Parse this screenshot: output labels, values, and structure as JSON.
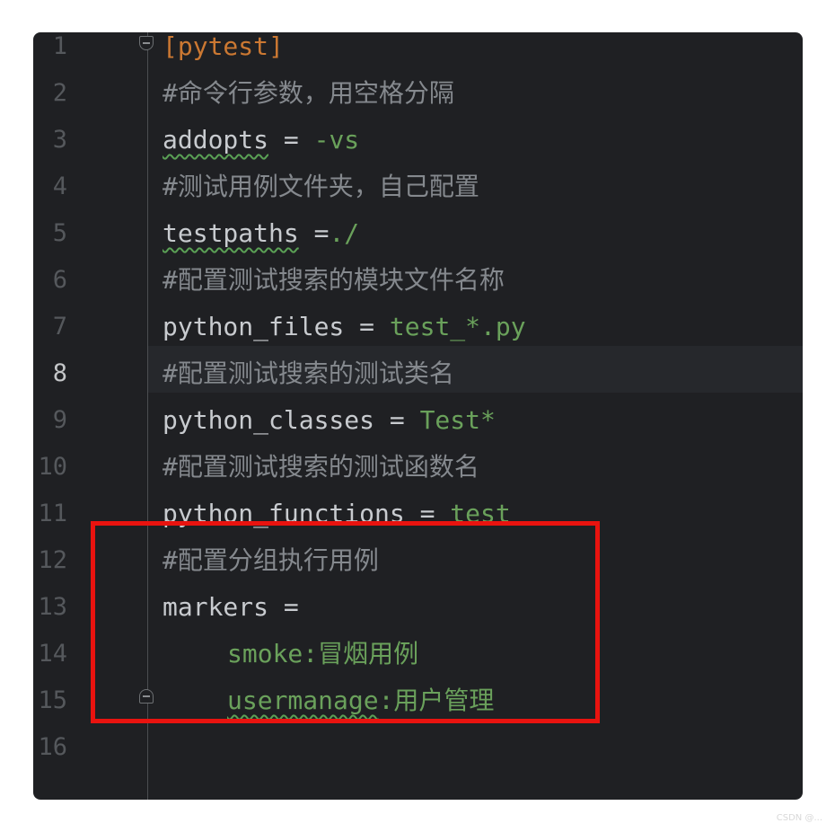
{
  "editor": {
    "active_line": "8",
    "lines": [
      {
        "num": "1",
        "parts": [
          {
            "t": "[pytest]",
            "cls": "s"
          }
        ]
      },
      {
        "num": "2",
        "parts": [
          {
            "t": "#命令行参数，用空格分隔",
            "cls": "c"
          }
        ]
      },
      {
        "num": "3",
        "parts": [
          {
            "t": "addopts",
            "cls": "k sq"
          },
          {
            "t": " = ",
            "cls": "k"
          },
          {
            "t": "-vs",
            "cls": "v"
          }
        ]
      },
      {
        "num": "4",
        "parts": [
          {
            "t": "#测试用例文件夹，自己配置",
            "cls": "c"
          }
        ]
      },
      {
        "num": "5",
        "parts": [
          {
            "t": "testpaths",
            "cls": "k sq"
          },
          {
            "t": " =",
            "cls": "k"
          },
          {
            "t": "./",
            "cls": "v"
          }
        ]
      },
      {
        "num": "6",
        "parts": [
          {
            "t": "#配置测试搜索的模块文件名称",
            "cls": "c"
          }
        ]
      },
      {
        "num": "7",
        "parts": [
          {
            "t": "python_files = ",
            "cls": "k"
          },
          {
            "t": "test_*.py",
            "cls": "v"
          }
        ]
      },
      {
        "num": "8",
        "parts": [
          {
            "t": "#配置测试搜索的测试类名",
            "cls": "c"
          }
        ]
      },
      {
        "num": "9",
        "parts": [
          {
            "t": "python_classes = ",
            "cls": "k"
          },
          {
            "t": "Test*",
            "cls": "v"
          }
        ]
      },
      {
        "num": "10",
        "parts": [
          {
            "t": "#配置测试搜索的测试函数名",
            "cls": "c"
          }
        ]
      },
      {
        "num": "11",
        "parts": [
          {
            "t": "python_functions = ",
            "cls": "k"
          },
          {
            "t": "test",
            "cls": "v"
          }
        ]
      },
      {
        "num": "12",
        "parts": [
          {
            "t": "#配置分组执行用例",
            "cls": "c"
          }
        ]
      },
      {
        "num": "13",
        "parts": [
          {
            "t": "markers =",
            "cls": "k"
          }
        ]
      },
      {
        "num": "14",
        "indent": true,
        "parts": [
          {
            "t": "smoke:冒烟用例",
            "cls": "v"
          }
        ]
      },
      {
        "num": "15",
        "indent": true,
        "parts": [
          {
            "t": "usermanage",
            "cls": "v sq"
          },
          {
            "t": ":用户管理",
            "cls": "v"
          }
        ]
      },
      {
        "num": "16",
        "parts": []
      }
    ]
  },
  "highlight": {
    "color": "#e9130f",
    "covers_lines": [
      "12",
      "13",
      "14",
      "15"
    ]
  },
  "watermark": "CSDN @..."
}
